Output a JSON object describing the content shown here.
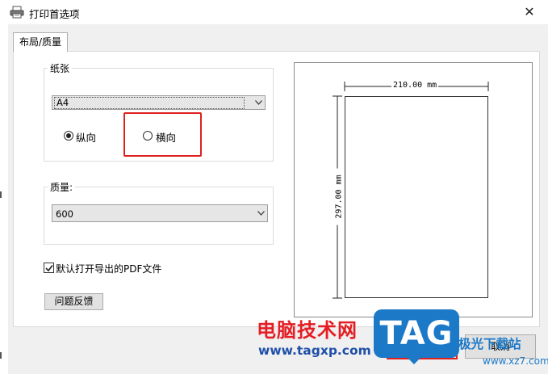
{
  "window": {
    "title": "打印首选项",
    "close_symbol": "✕",
    "icon": "printer-icon"
  },
  "tab": {
    "label": "布局/质量"
  },
  "paper_group": {
    "label": "纸张",
    "size_value": "A4",
    "orientation": {
      "portrait_label": "纵向",
      "landscape_label": "横向",
      "selected": "portrait"
    }
  },
  "quality_group": {
    "label": "质量:",
    "value": "600"
  },
  "options": {
    "open_pdf_label": "默认打开导出的PDF文件",
    "open_pdf_checked": true
  },
  "buttons": {
    "feedback": "问题反馈",
    "cancel": "取消",
    "ok": ""
  },
  "preview": {
    "width_label": "210.00 mm",
    "height_label": "297.00 mm"
  },
  "watermark": {
    "site_name": "电脑技术网",
    "site_url": "www.tagxp.com",
    "badge": "TAG",
    "second_site": "极光下载站",
    "second_url": "www.xz7.com"
  },
  "colors": {
    "highlight_red": "#e0201f",
    "watermark_blue": "#1b79c8",
    "watermark_red": "#e31e24"
  }
}
